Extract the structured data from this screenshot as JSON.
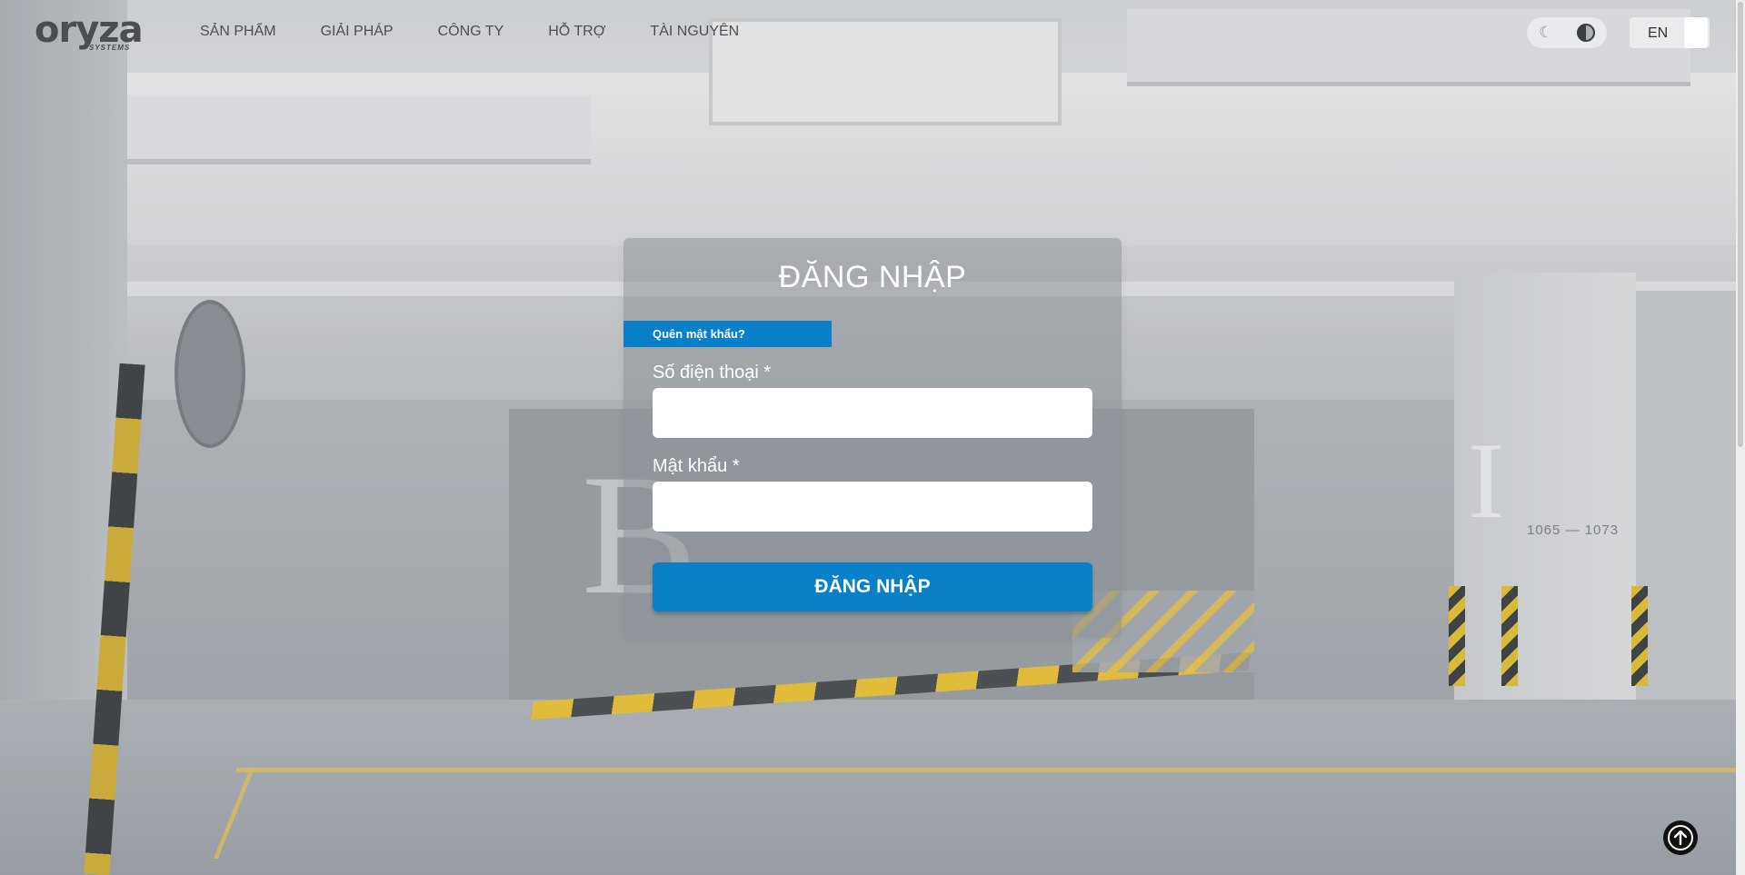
{
  "brand": {
    "logo_text": "oryza",
    "logo_subtext": "SYSTEMS"
  },
  "nav": {
    "items": [
      {
        "label": "SẢN PHẨM"
      },
      {
        "label": "GIẢI PHÁP"
      },
      {
        "label": "CÔNG TY"
      },
      {
        "label": "HỖ TRỢ"
      },
      {
        "label": "TÀI NGUYÊN"
      }
    ]
  },
  "header": {
    "theme_icons": [
      "moon-icon",
      "contrast-icon"
    ],
    "language": "EN"
  },
  "login": {
    "title": "ĐĂNG NHẬP",
    "forgot_password": "Quên mật khẩu?",
    "phone_label": "Số điện thoại *",
    "phone_value": "",
    "password_label": "Mật khẩu *",
    "password_value": "",
    "submit_label": "ĐĂNG NHẬP"
  },
  "background": {
    "sign_letter_left": "B",
    "sign_letter_right": "I",
    "plate_text": "1065 — 1073"
  },
  "colors": {
    "accent": "#0a80c8",
    "nav_text": "#4c4f54",
    "card_bg": "#8c9298"
  }
}
